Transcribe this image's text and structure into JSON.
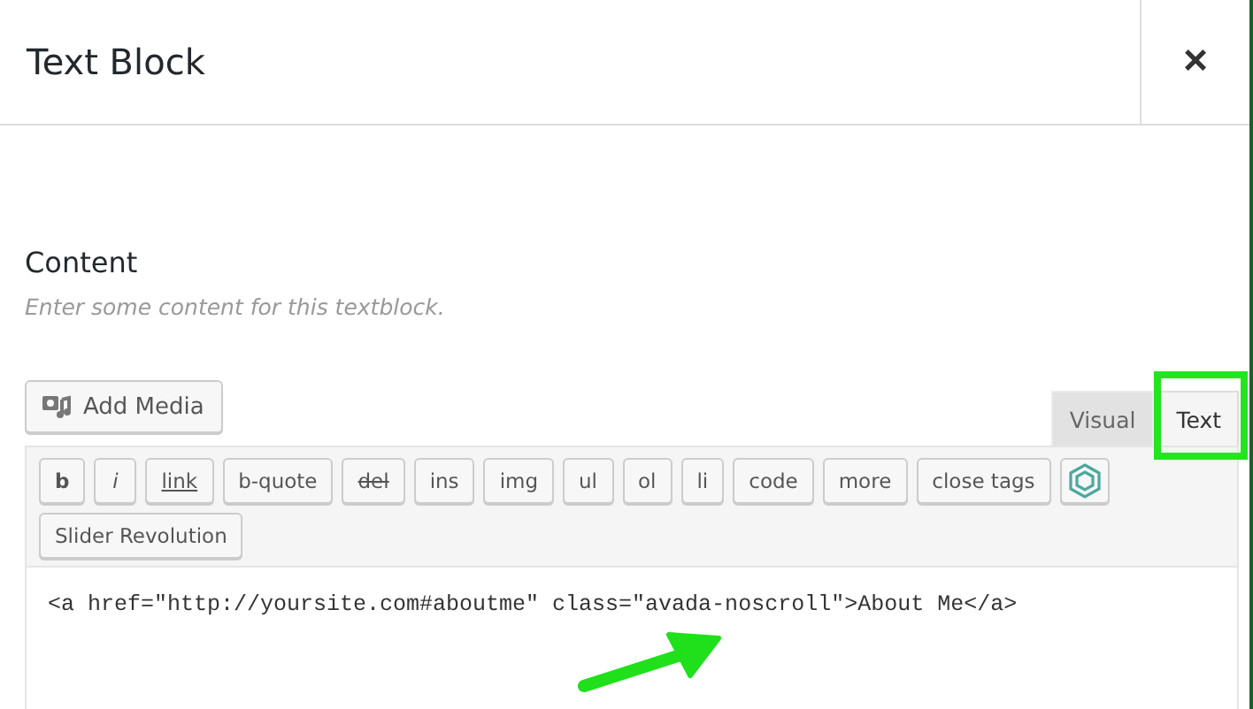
{
  "dialog": {
    "title": "Text Block",
    "close": "×"
  },
  "field": {
    "label": "Content",
    "description": "Enter some content for this textblock."
  },
  "editor": {
    "add_media": "Add Media",
    "tabs": [
      {
        "label": "Visual",
        "selected": false
      },
      {
        "label": "Text",
        "selected": true,
        "highlighted": true
      }
    ],
    "quicktags": [
      {
        "label": "b",
        "kind": "bold"
      },
      {
        "label": "i",
        "kind": "italic"
      },
      {
        "label": "link",
        "kind": "underline"
      },
      {
        "label": "b-quote",
        "kind": "plain"
      },
      {
        "label": "del",
        "kind": "strike"
      },
      {
        "label": "ins",
        "kind": "plain"
      },
      {
        "label": "img",
        "kind": "plain"
      },
      {
        "label": "ul",
        "kind": "plain"
      },
      {
        "label": "ol",
        "kind": "plain"
      },
      {
        "label": "li",
        "kind": "plain"
      },
      {
        "label": "code",
        "kind": "plain"
      },
      {
        "label": "more",
        "kind": "plain"
      },
      {
        "label": "close tags",
        "kind": "plain"
      },
      {
        "kind": "icon"
      },
      {
        "label": "Slider Revolution",
        "kind": "plain"
      }
    ],
    "content": "<a href=\"http://yoursite.com#aboutme\" class=\"avada-noscroll\">About Me</a>"
  }
}
